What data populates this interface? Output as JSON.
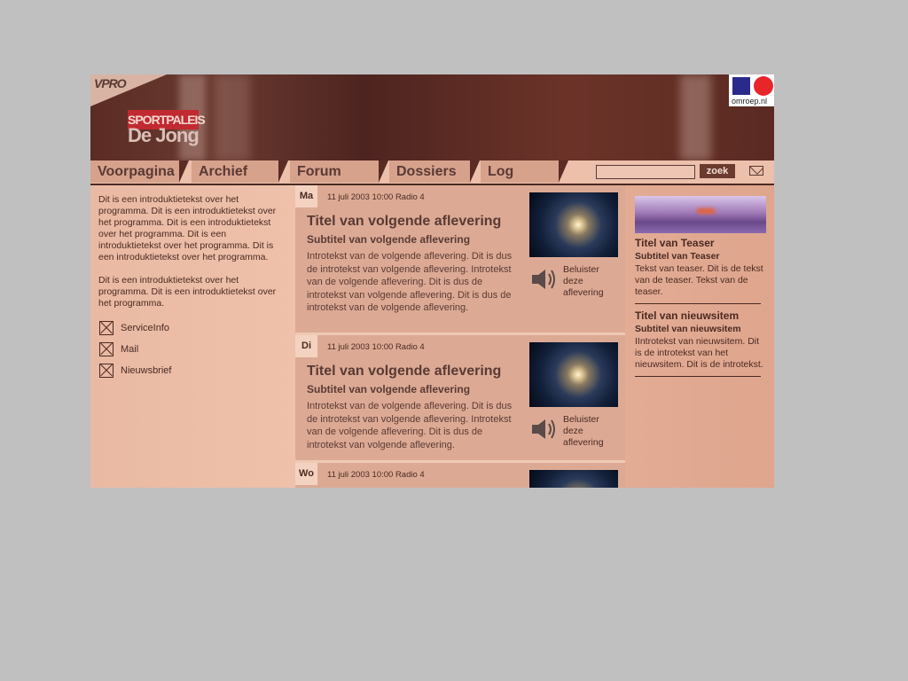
{
  "header": {
    "broadcaster_logo": "VPRO",
    "show_logo_top": "SPORTPALEIS",
    "show_logo_bottom": "De Jong",
    "omroep_label": "omroep.nl"
  },
  "nav": {
    "tabs": [
      "Voorpagina",
      "Archief",
      "Forum",
      "Dossiers",
      "Log"
    ],
    "search": {
      "value": "",
      "button_label": "zoek"
    }
  },
  "left": {
    "intro_1": "Dit is een introduktietekst over het programma. Dit is een introduktietekst over het programma. Dit is een introduktietekst over het programma. Dit is een introduktietekst over het programma. Dit is een introduktietekst over het programma.",
    "intro_2": "Dit is een introduktietekst over het programma. Dit is een introduktietekst over het programma.",
    "links": [
      "ServiceInfo",
      "Mail",
      "Nieuwsbrief"
    ]
  },
  "episodes": [
    {
      "day": "Ma",
      "date": "11 juli 2003 10:00 Radio 4",
      "title": "Titel van volgende aflevering",
      "subtitle": "Subtitel van volgende aflevering",
      "intro": "Introtekst van de volgende aflevering. Dit is dus de introtekst van volgende aflevering. Introtekst van de volgende aflevering. Dit is dus de introtekst van volgende aflevering. Dit is dus de introtekst van de volgende aflevering.",
      "listen_label": "Beluister deze aflevering"
    },
    {
      "day": "Di",
      "date": "11 juli 2003 10:00 Radio 4",
      "title": "Titel van volgende aflevering",
      "subtitle": "Subtitel van volgende aflevering",
      "intro": "Introtekst van de volgende aflevering. Dit is dus de introtekst van volgende aflevering. Introtekst van de volgende aflevering. Dit is dus de introtekst van volgende aflevering.",
      "listen_label": "Beluister deze aflevering"
    },
    {
      "day": "Wo",
      "date": "11 juli 2003 10:00 Radio 4"
    }
  ],
  "right": {
    "teaser": {
      "title": "Titel van Teaser",
      "subtitle": "Subtitel van Teaser",
      "text": "Tekst van teaser. Dit is de tekst van de teaser. Tekst van de teaser."
    },
    "news": {
      "title": "Titel van nieuwsitem",
      "subtitle": "Subtitel van nieuwsitem",
      "text": "IIntrotekst van nieuwsitem. Dit is de introtekst van het nieuwsitem. Dit is de introtekst."
    }
  }
}
